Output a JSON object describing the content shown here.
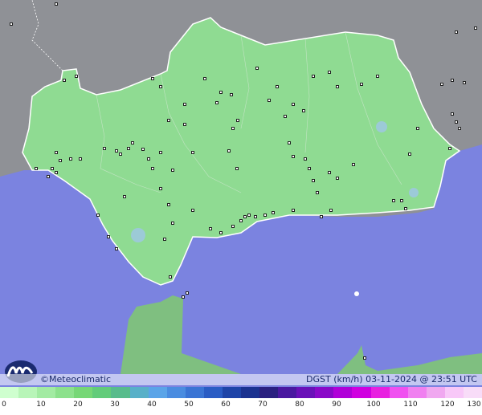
{
  "footer": {
    "credit": "©Meteoclimatic",
    "stamp": "DGST (km/h)  03-11-2024 @ 23:51 UTC"
  },
  "legend": {
    "ticks": [
      "0",
      "10",
      "20",
      "30",
      "40",
      "50",
      "60",
      "70",
      "80",
      "90",
      "100",
      "110",
      "120",
      "130"
    ],
    "colors": [
      "#cfffcf",
      "#b8f5b8",
      "#a2eba2",
      "#8ce18c",
      "#76d776",
      "#62cc7a",
      "#58bc8c",
      "#58b0c8",
      "#5aa4e8",
      "#4a8ce0",
      "#3a74d4",
      "#2a5cc4",
      "#1e44a8",
      "#1a3290",
      "#2a2080",
      "#4a18a0",
      "#6a10b8",
      "#8a08c8",
      "#b000d8",
      "#d000e0",
      "#e820e0",
      "#f050f0",
      "#f080f0",
      "#f0a8f0",
      "#f8c8f8",
      "#f8dcf8"
    ]
  },
  "colors": {
    "sea": "#7b83e0",
    "land_other": "#8e9096",
    "andalusia": "#8fdb92",
    "morocco": "#7fbf80"
  }
}
